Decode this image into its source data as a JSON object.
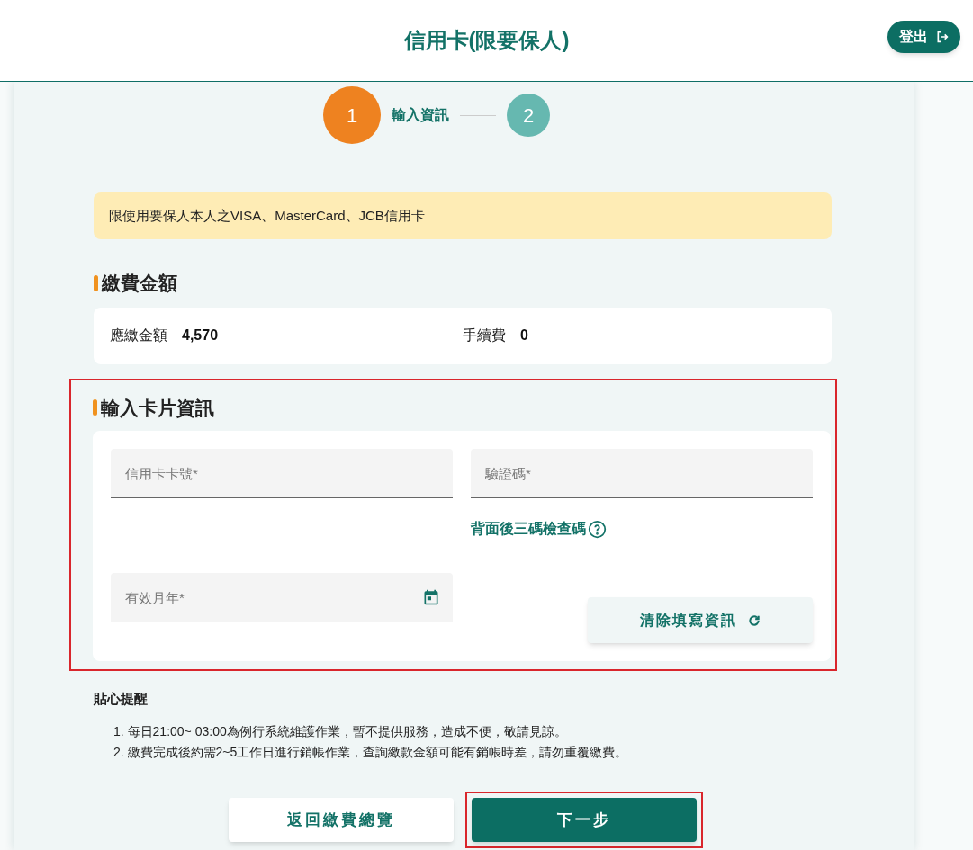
{
  "header": {
    "title": "信用卡(限要保人)",
    "logout_button": "登出"
  },
  "steps": [
    {
      "number": "1",
      "label": "輸入資訊",
      "selected": true
    },
    {
      "number": "2",
      "selected": false
    }
  ],
  "notice": "限使用要保人本人之VISA、MasterCard、JCB信用卡",
  "amount_section": {
    "title": "繳費金額",
    "items": [
      {
        "label": "應繳金額",
        "value": "4,570"
      },
      {
        "label": "手續費",
        "value": "0"
      }
    ]
  },
  "card_section": {
    "title": "輸入卡片資訊",
    "highlighted": true,
    "card_number": {
      "placeholder": "信用卡卡號*"
    },
    "cvv": {
      "placeholder": "驗證碼*"
    },
    "cvv_help_link": "背面後三碼檢查碼",
    "expiry": {
      "placeholder": "有效月年*"
    },
    "clear_button": "清除填寫資訊"
  },
  "tips": {
    "title": "貼心提醒",
    "items": [
      "1. 每日21:00~ 03:00為例行系統維護作業，暫不提供服務，造成不便，敬請見諒。",
      "2. 繳費完成後約需2~5工作日進行銷帳作業，查詢繳款金額可能有銷帳時差，請勿重覆繳費。"
    ]
  },
  "buttons": [
    {
      "label": "返回繳費總覽",
      "kind": "secondary",
      "highlighted": false
    },
    {
      "label": "下一步",
      "kind": "primary",
      "highlighted": true
    }
  ]
}
